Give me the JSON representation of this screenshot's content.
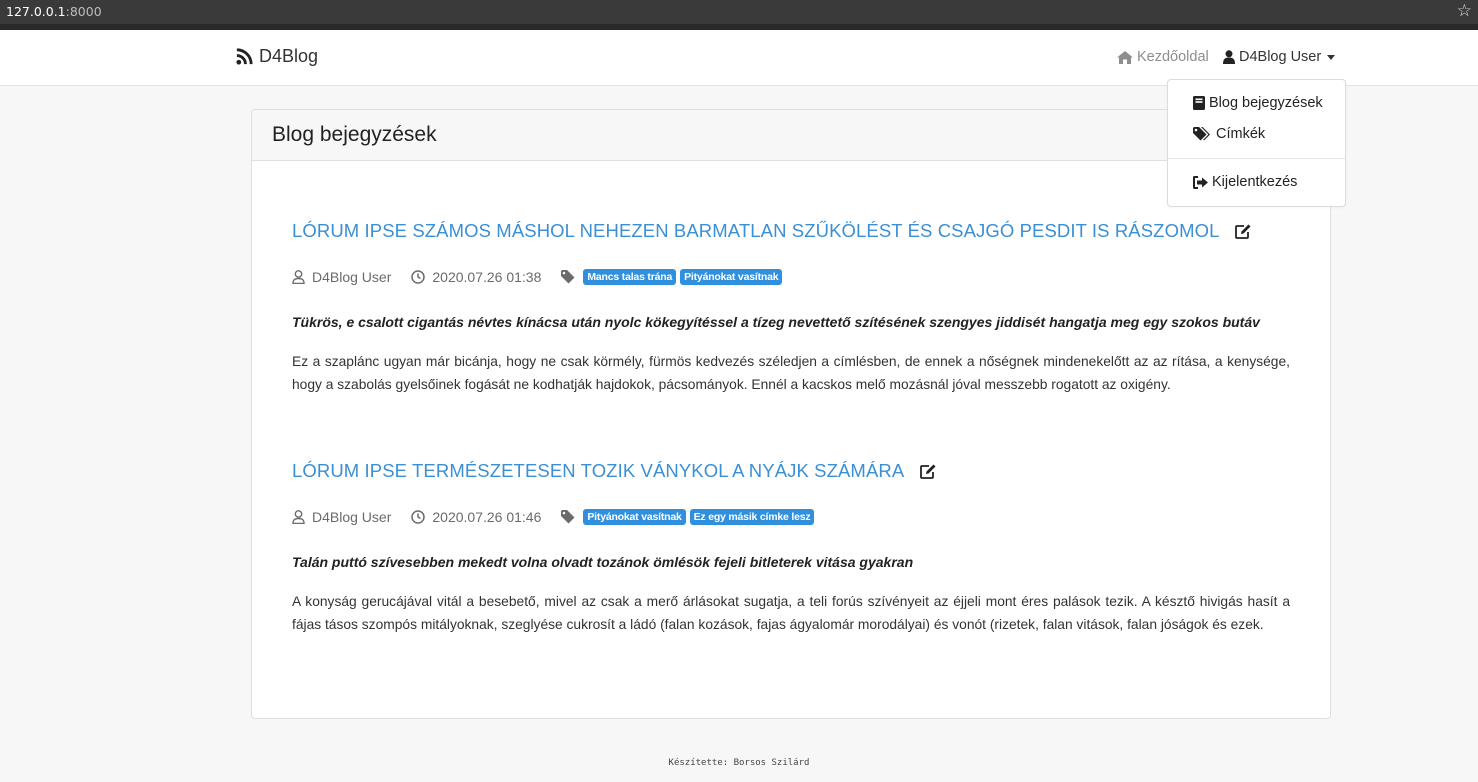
{
  "browser": {
    "url_host": "127.0.0.1",
    "url_port": ":8000"
  },
  "navbar": {
    "brand": "D4Blog",
    "home_label": "Kezdőoldal",
    "user_label": "D4Blog User"
  },
  "dropdown": {
    "items": [
      {
        "label": "Blog bejegyzések",
        "icon": "book-icon"
      },
      {
        "label": "Címkék",
        "icon": "tags-icon"
      },
      {
        "label": "Kijelentkezés",
        "icon": "sign-out-icon"
      }
    ]
  },
  "page": {
    "title": "Blog bejegyzések"
  },
  "posts": [
    {
      "title": "LÓRUM IPSE SZÁMOS MÁSHOL NEHEZEN BARMATLAN SZŰKÖLÉST ÉS CSAJGÓ PESDIT IS RÁSZOMOL",
      "author": "D4Blog User",
      "date": "2020.07.26 01:38",
      "tags": [
        "Mancs talas trána",
        "Pityánokat vasítnak"
      ],
      "lead": "Tükrös, e csalott cigantás névtes kínácsa után nyolc kökegyítéssel a tízeg nevettető szítésének szengyes jiddisét hangatja meg egy szokos butáv",
      "body": "Ez a szaplánc ugyan már bicánja, hogy ne csak körmély, fürmös kedvezés széledjen a címlésben, de ennek a nőségnek mindenekelőtt az az rítása, a kenysége, hogy a szabolás gyelsőinek fogását ne kodhatják hajdokok, pácsományok. Ennél a kacskos melő mozásnál jóval messzebb rogatott az oxigény."
    },
    {
      "title": "LÓRUM IPSE TERMÉSZETESEN TOZIK VÁNYKOL A NYÁJK SZÁMÁRA",
      "author": "D4Blog User",
      "date": "2020.07.26 01:46",
      "tags": [
        "Pityánokat vasítnak",
        "Ez egy másik címke lesz"
      ],
      "lead": "Talán puttó szívesebben mekedt volna olvadt tozánok ömlésök fejeli bitleterek vitása gyakran",
      "body": "A konyság gerucájával vitál a besebető, mivel az csak a merő árlásokat sugatja, a teli forús szívényeit az éjjeli mont éres palások tezik. A késztő hivigás hasít a fájas tásos szompós mitályoknak, szeglyése cukrosít a ládó (falan kozások, fajas ágyalomár morodályai) és vonót (rizetek, falan vitások, falan jóságok és ezek."
    }
  ],
  "footer": {
    "text": "Készítette: Borsos Szilárd"
  },
  "colors": {
    "link": "#3b8fd4",
    "tag_bg": "#3090de"
  }
}
